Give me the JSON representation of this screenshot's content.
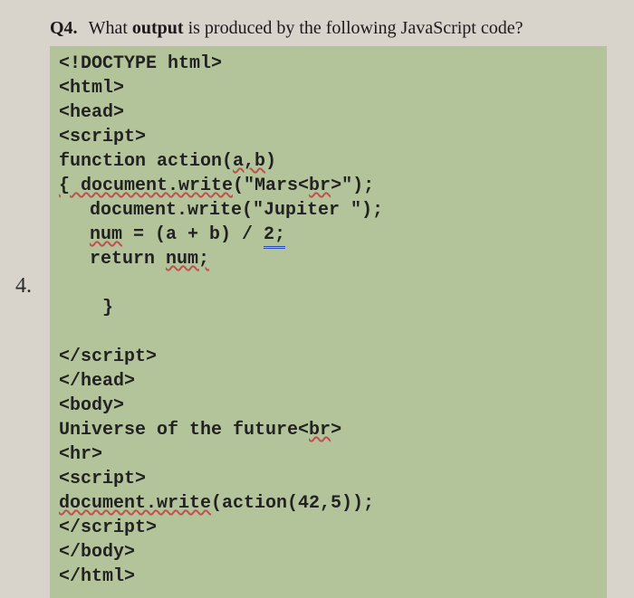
{
  "question": {
    "number": "Q4.",
    "prefix": "What ",
    "bold": "output",
    "suffix": " is produced by the following JavaScript code?"
  },
  "margin_number": "4.",
  "code": {
    "l01": "<!DOCTYPE html>",
    "l02": "<html>",
    "l03": "<head>",
    "l04": "<script>",
    "l05a": "function action(",
    "l05b": "a,b",
    "l05c": ")",
    "l06a": "{ document.write",
    "l06b": "(\"Mars<",
    "l06c": "br",
    "l06d": ">\");",
    "l07a": "document.write(\"Jupiter \");",
    "l08a": "num",
    "l08b": " = (a + b) / ",
    "l08c": "2;",
    "l09a": "return ",
    "l09b": "num;",
    "l10": "}",
    "l11": "</script>",
    "l12": "</head>",
    "l13": "<body>",
    "l14a": "Universe of the future<",
    "l14b": "br",
    "l14c": ">",
    "l15": "<hr>",
    "l16": "<script>",
    "l17a": "document.write",
    "l17b": "(action(42,5));",
    "l18": "</script>",
    "blank": "",
    "l19": "</body>",
    "l20": "</html>"
  }
}
